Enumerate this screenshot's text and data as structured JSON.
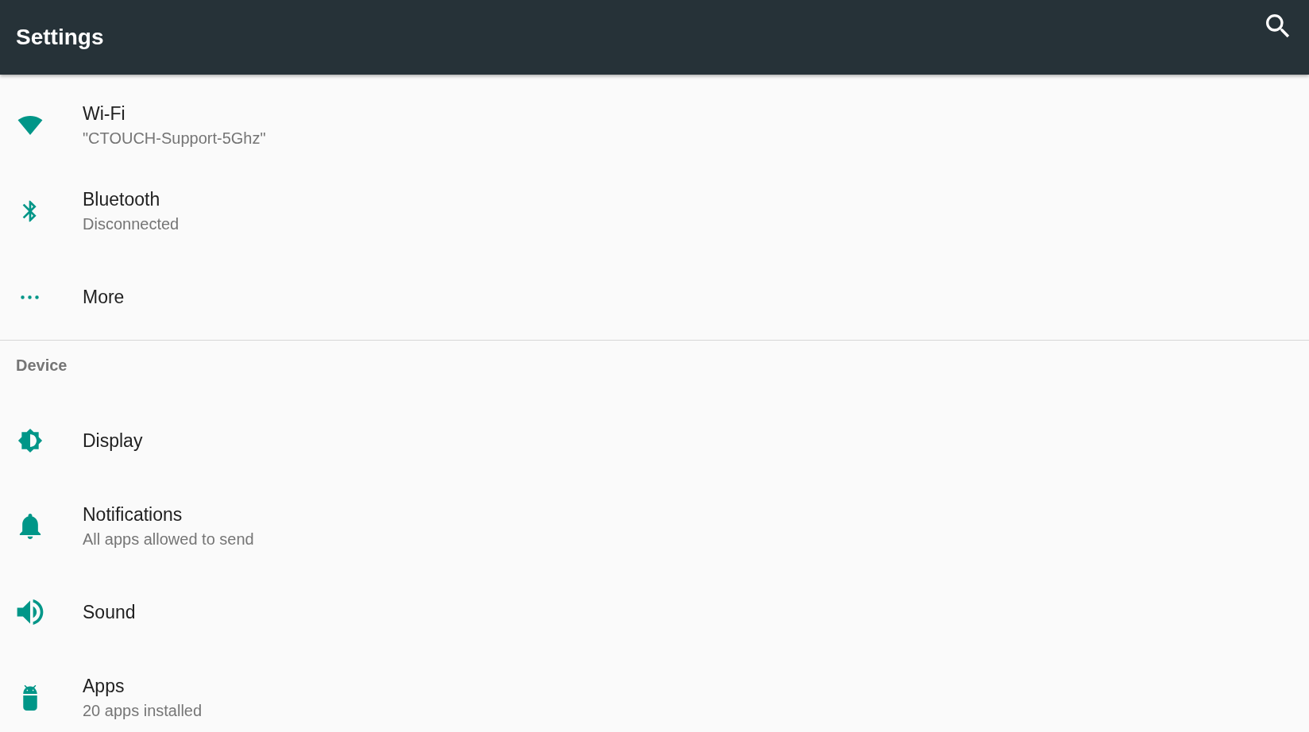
{
  "app_bar": {
    "title": "Settings"
  },
  "sections": [
    {
      "items": [
        {
          "title": "Wi-Fi",
          "subtitle": "\"CTOUCH-Support-5Ghz\""
        },
        {
          "title": "Bluetooth",
          "subtitle": "Disconnected"
        },
        {
          "title": "More"
        }
      ]
    },
    {
      "title": "Device",
      "items": [
        {
          "title": "Display"
        },
        {
          "title": "Notifications",
          "subtitle": "All apps allowed to send"
        },
        {
          "title": "Sound"
        },
        {
          "title": "Apps",
          "subtitle": "20 apps installed"
        }
      ]
    }
  ]
}
